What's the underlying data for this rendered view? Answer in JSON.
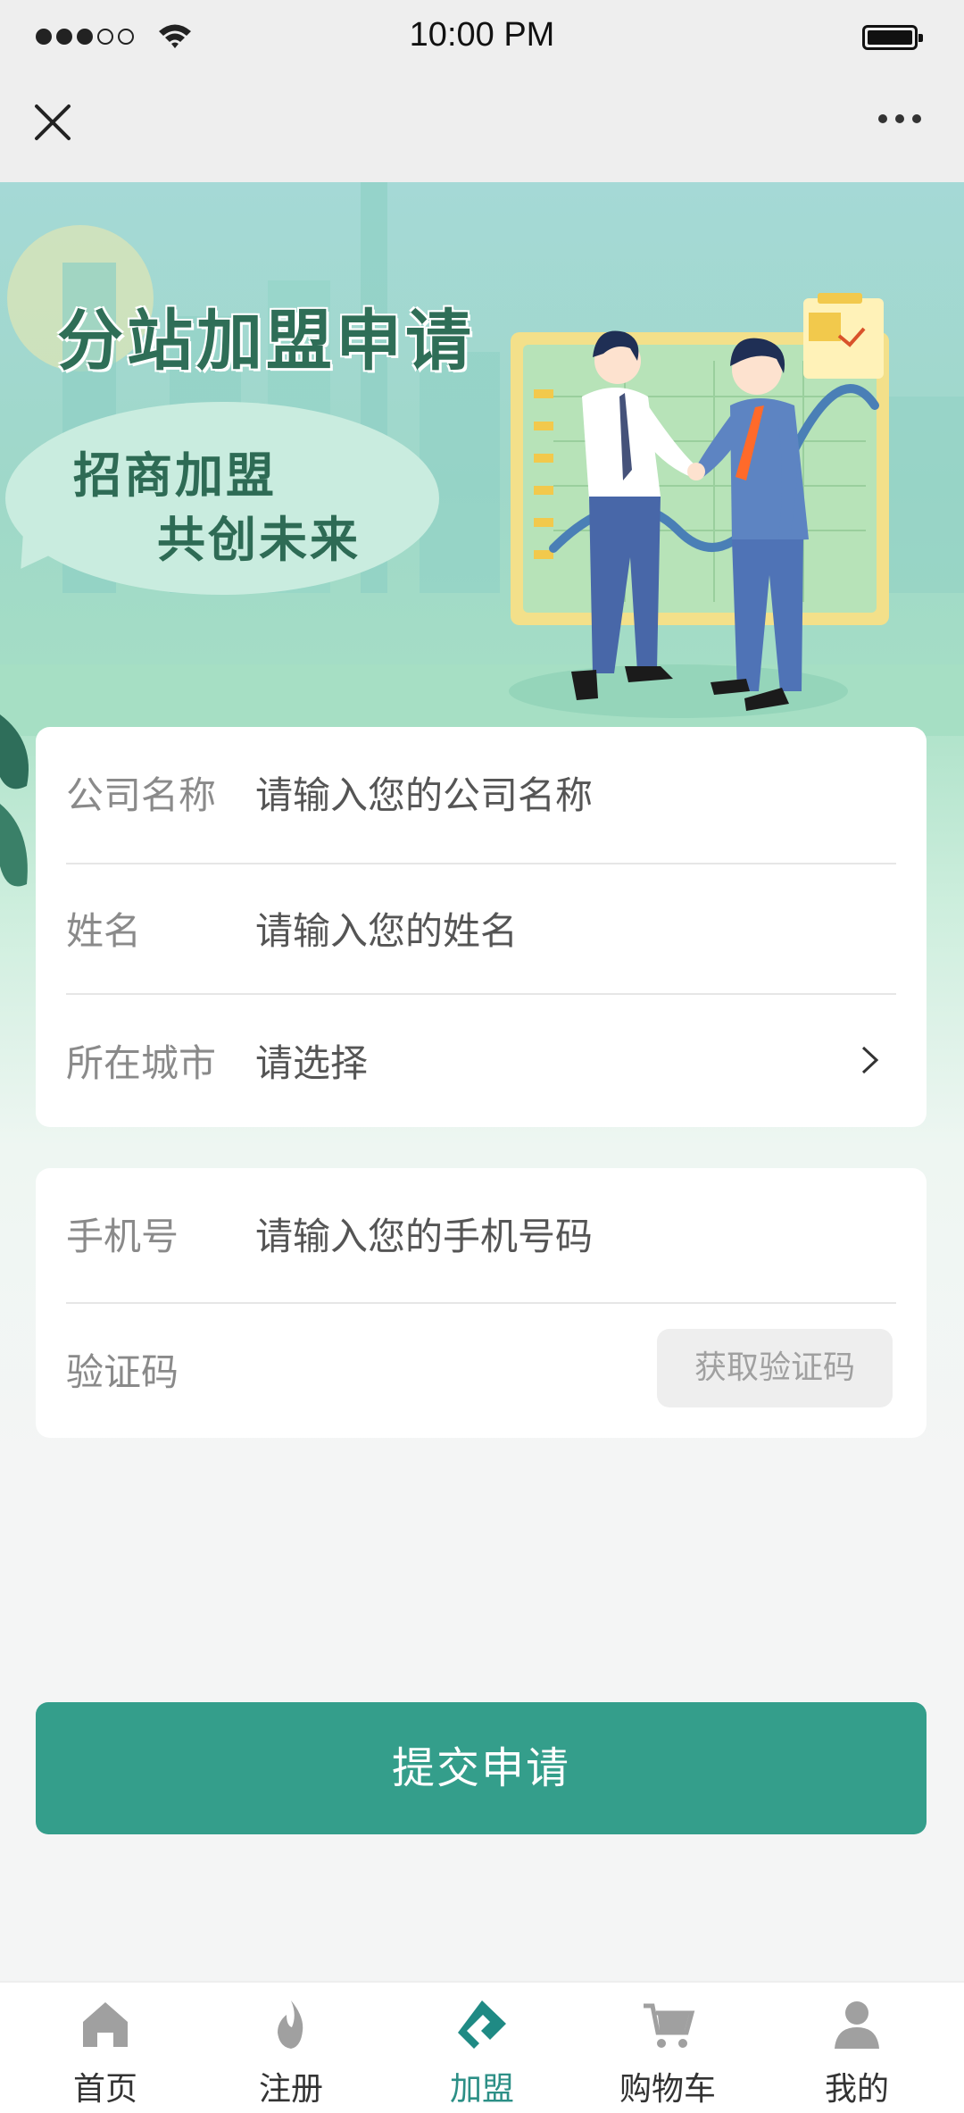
{
  "status_bar": {
    "time": "10:00 PM",
    "signal_filled": 3,
    "signal_total": 5,
    "battery_level": 1.0
  },
  "nav_bar": {
    "close_icon": "close-icon",
    "more_icon": "more-icon"
  },
  "banner": {
    "title": "分站加盟申请",
    "slogan_line1": "招商加盟",
    "slogan_line2": "共创未来"
  },
  "form_basic": {
    "company": {
      "label": "公司名称",
      "placeholder": "请输入您的公司名称"
    },
    "name": {
      "label": "姓名",
      "placeholder": "请输入您的姓名"
    },
    "city": {
      "label": "所在城市",
      "value": "请选择"
    }
  },
  "form_contact": {
    "phone": {
      "label": "手机号",
      "placeholder": "请输入您的手机号码"
    },
    "code": {
      "label": "验证码",
      "button": "获取验证码"
    }
  },
  "submit_label": "提交申请",
  "tab_bar": {
    "items": [
      {
        "label": "首页",
        "icon": "home-icon"
      },
      {
        "label": "注册",
        "icon": "flame-icon"
      },
      {
        "label": "加盟",
        "icon": "join-icon",
        "active": true
      },
      {
        "label": "购物车",
        "icon": "cart-icon"
      },
      {
        "label": "我的",
        "icon": "user-icon"
      }
    ]
  },
  "colors": {
    "accent": "#349e8b",
    "tab_active": "#2c8f86",
    "banner_title": "#2f6e57"
  }
}
